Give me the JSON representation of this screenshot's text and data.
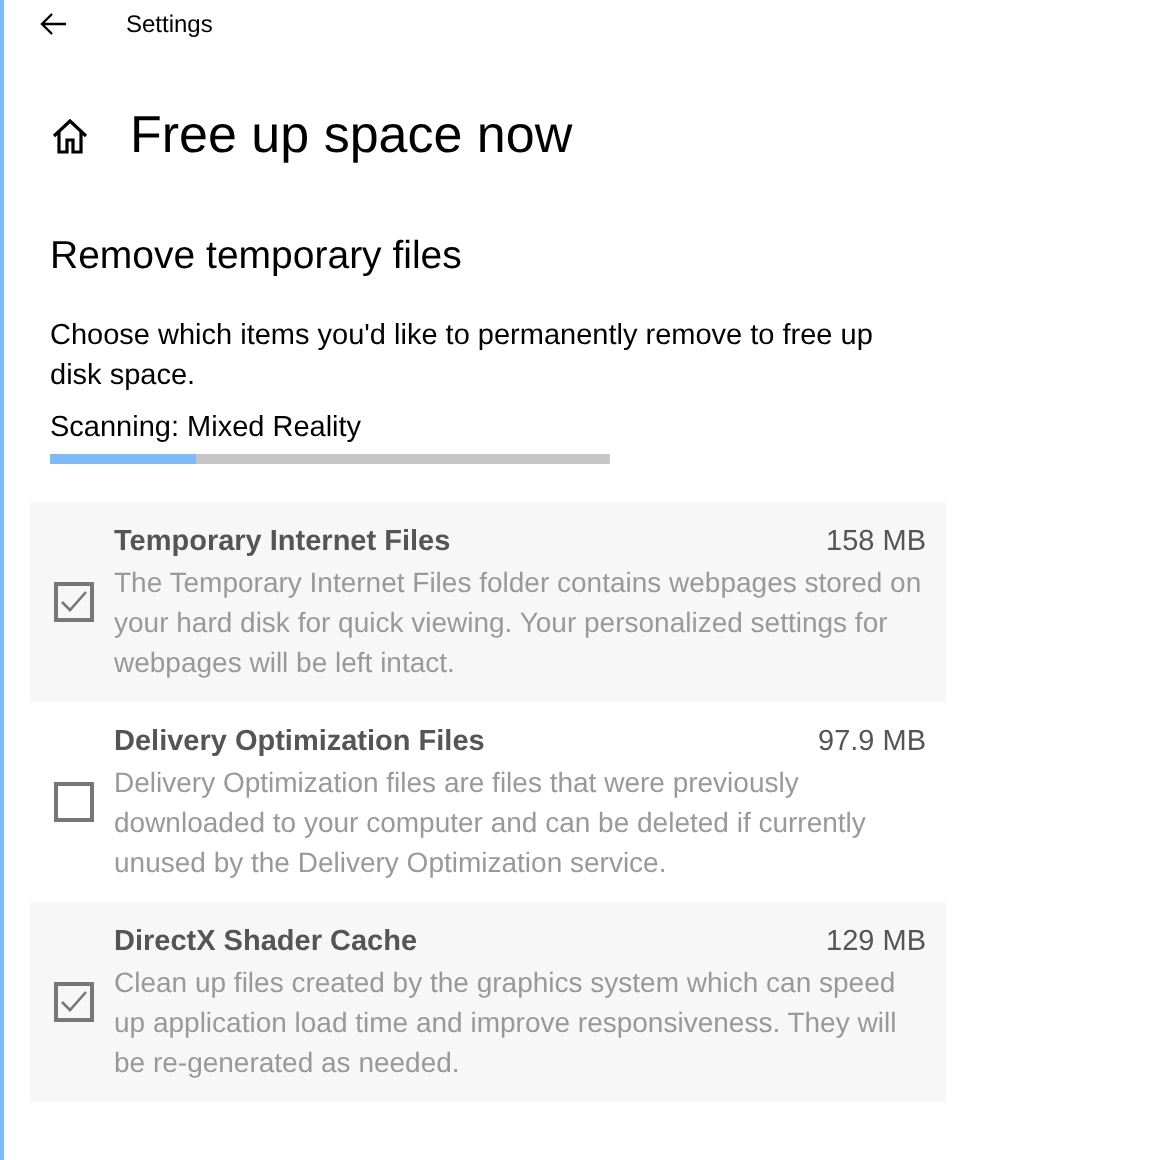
{
  "window": {
    "title": "Settings"
  },
  "page_title": "Free up space now",
  "section": {
    "heading": "Remove temporary files",
    "description": "Choose which items you'd like to permanently remove to free up disk space.",
    "scan_status": "Scanning: Mixed Reality",
    "level": 0.26
  },
  "items": [
    {
      "name": "Temporary Internet Files",
      "size": "158 MB",
      "description": "The Temporary Internet Files folder contains webpages stored on your hard disk for quick viewing. Your personalized settings for webpages will be left intact.",
      "checked": true,
      "disabled": true
    },
    {
      "name": "Delivery Optimization Files",
      "size": "97.9 MB",
      "description": "Delivery Optimization files are files that were previously downloaded to your computer and can be deleted if currently unused by the Delivery Optimization service.",
      "checked": false,
      "disabled": true
    },
    {
      "name": "DirectX Shader Cache",
      "size": "129 MB",
      "description": "Clean up files created by the graphics system which can speed up application load time and improve responsiveness. They will be re-generated as needed.",
      "checked": true,
      "disabled": true
    }
  ]
}
